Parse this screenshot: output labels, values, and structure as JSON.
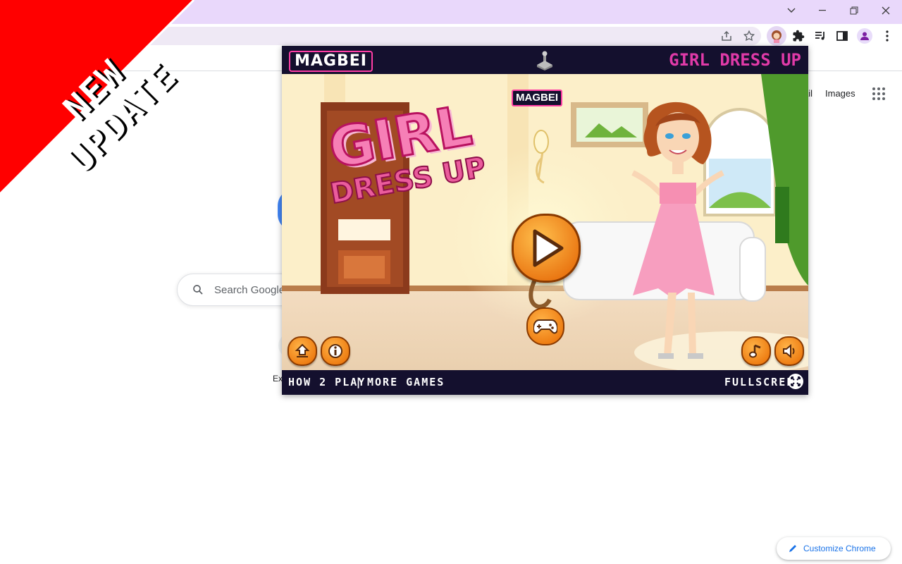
{
  "browser": {
    "toolbar_icons": [
      "share-icon",
      "star-icon",
      "extension-dressup-icon",
      "puzzle-icon",
      "media-icon",
      "sidepanel-icon",
      "profile-icon",
      "menu-icon"
    ],
    "window_controls": [
      "chevron-down-icon",
      "minimize-icon",
      "restore-icon",
      "close-icon"
    ]
  },
  "google": {
    "links": {
      "gmail": "ail",
      "images": "Images"
    },
    "search_placeholder": "Search Google",
    "shortcut_label": "Ex",
    "customize_label": "Customize Chrome"
  },
  "banner": {
    "line1": "NEW",
    "line2": "UPDATE",
    "color": "#ff0000"
  },
  "game": {
    "brand": "MAGBEI",
    "header_title": "GIRL DRESS UP",
    "stage_brand": "MAGBEI",
    "title_line1": "GIRL",
    "title_line2": "DRESS UP",
    "watermark": "MAGBEI",
    "footer": {
      "how_to_play": "HOW 2 PLAY",
      "separator": "|",
      "more_games": "MORE GAMES",
      "fullscreen": "FULLSCREEN"
    },
    "colors": {
      "header_bg": "#14102e",
      "title_pink": "#e03aa8",
      "button_orange": "#f28a00"
    }
  }
}
